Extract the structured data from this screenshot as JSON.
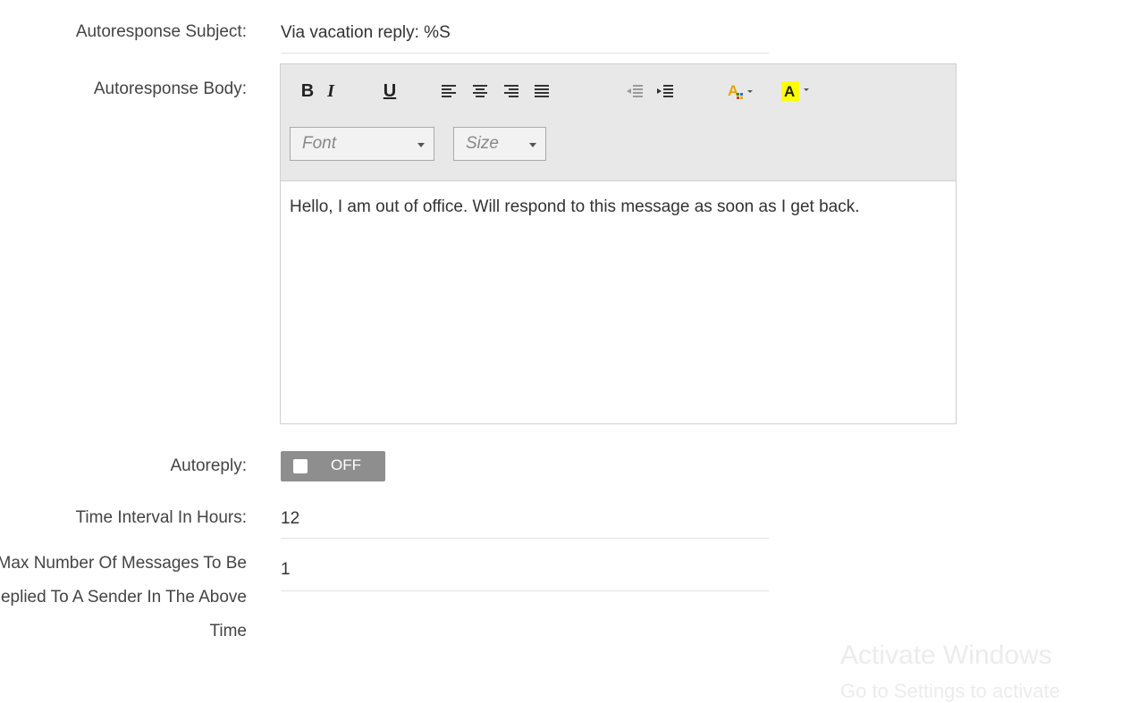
{
  "subject": {
    "label": "Autoresponse Subject:",
    "value": "Via vacation reply: %S"
  },
  "body": {
    "label": "Autoresponse Body:",
    "toolbar": {
      "bold": "B",
      "italic": "I",
      "underline": "U",
      "font_placeholder": "Font",
      "size_placeholder": "Size",
      "font_color_icon": "font-color-icon",
      "highlight_icon": "highlight-icon",
      "highlight_color": "#ffff00",
      "font_color": "#f0a000"
    },
    "text": "Hello, I am out of office. Will respond to this message as soon as I get back."
  },
  "autoreply": {
    "label": "Autoreply:",
    "state": "OFF"
  },
  "interval": {
    "label": "Time Interval In Hours:",
    "value": "12"
  },
  "max_messages": {
    "label": "Max Number Of Messages To Be Replied To A Sender In The Above Time",
    "value": "1"
  },
  "watermark": {
    "title": "Activate Windows",
    "subtitle": "Go to Settings to activate"
  }
}
